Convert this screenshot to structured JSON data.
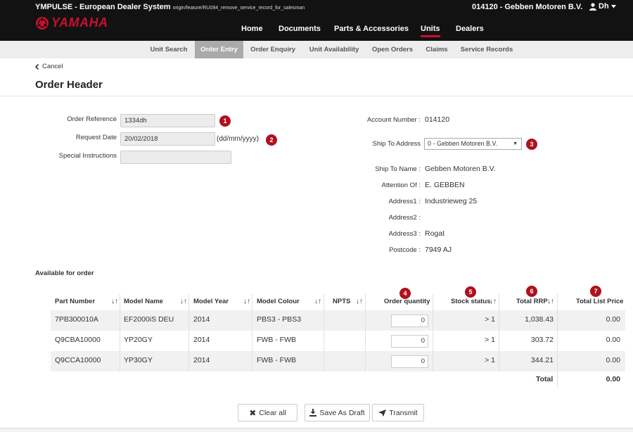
{
  "header": {
    "system_name": "YMPULSE - European Dealer System",
    "branch": "origin/feature/RU094_remove_service_record_for_salesman",
    "dealer": "014120 - Gebben Motoren B.V.",
    "user": "Dh",
    "logo_text": "YAMAHA"
  },
  "nav": [
    "Home",
    "Documents",
    "Parts & Accessories",
    "Units",
    "Dealers"
  ],
  "nav_active": "Units",
  "subnav": [
    "Unit Search",
    "Order Entry",
    "Order Enquiry",
    "Unit Availability",
    "Open Orders",
    "Claims",
    "Service Records"
  ],
  "subnav_active": "Order Entry",
  "cancel_label": "Cancel",
  "page_title": "Order Header",
  "form": {
    "order_reference_label": "Order Reference",
    "order_reference_value": "1334dh",
    "request_date_label": "Request Date",
    "request_date_value": "20/02/2018",
    "request_date_hint": "(dd/mm/yyyy)",
    "special_instructions_label": "Special Instructions",
    "special_instructions_value": "",
    "account_number_label": "Account Number :",
    "account_number_value": "014120",
    "ship_to_address_label": "Ship To Address",
    "ship_to_address_value": "0 - Gebben Motoren B.V.",
    "ship_to_name_label": "Ship To Name :",
    "ship_to_name_value": "Gebben Motoren B.V.",
    "attention_of_label": "Attention Of :",
    "attention_of_value": "E. GEBBEN",
    "address1_label": "Address1 :",
    "address1_value": "Industrieweg 25",
    "address2_label": "Address2 :",
    "address2_value": "",
    "address3_label": "Address3 :",
    "address3_value": "Rogat",
    "postcode_label": "Postcode :",
    "postcode_value": "7949 AJ"
  },
  "badges": [
    "1",
    "2",
    "3",
    "4",
    "5",
    "6",
    "7"
  ],
  "available_label": "Available for order",
  "table": {
    "headers": [
      "Part Number",
      "Model Name",
      "Model Year",
      "Model Colour",
      "NPTS",
      "Order quantity",
      "Stock status",
      "Total RRP",
      "Total List Price"
    ],
    "rows": [
      {
        "part": "7PB300010A",
        "model": "EF2000iS DEU",
        "year": "2014",
        "colour": "PBS3 - PBS3",
        "npts": "",
        "qty": "0",
        "stock": "> 1",
        "rrp": "1,038.43",
        "list": "0.00"
      },
      {
        "part": "Q9CBA10000",
        "model": "YP20GY",
        "year": "2014",
        "colour": "FWB - FWB",
        "npts": "",
        "qty": "0",
        "stock": "> 1",
        "rrp": "303.72",
        "list": "0.00"
      },
      {
        "part": "Q9CCA10000",
        "model": "YP30GY",
        "year": "2014",
        "colour": "FWB - FWB",
        "npts": "",
        "qty": "0",
        "stock": "> 1",
        "rrp": "344.21",
        "list": "0.00"
      }
    ],
    "total_label": "Total",
    "total_value": "0.00",
    "sort_glyph": "↓↑"
  },
  "buttons": {
    "clear_all": "Clear all",
    "save_as_draft": "Save As Draft",
    "transmit": "Transmit"
  },
  "colors": {
    "header_bg": "#121212",
    "accent_red": "#c8102e",
    "badge_red": "#b0101e",
    "subnav_active": "#aaaaaa"
  }
}
